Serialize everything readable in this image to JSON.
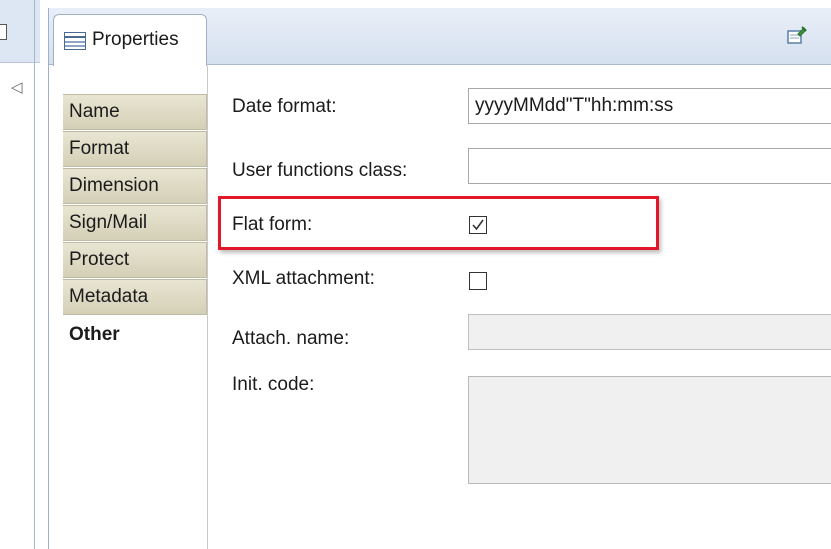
{
  "view": {
    "tab_title": "Properties",
    "tab_icon": "properties-table-icon",
    "toolbar_icon": "pin-editor-icon"
  },
  "tabs": [
    {
      "label": "Name",
      "active": false
    },
    {
      "label": "Format",
      "active": false
    },
    {
      "label": "Dimension",
      "active": false
    },
    {
      "label": "Sign/Mail",
      "active": false
    },
    {
      "label": "Protect",
      "active": false
    },
    {
      "label": "Metadata",
      "active": false
    },
    {
      "label": "Other",
      "active": true
    }
  ],
  "form": {
    "date_format_label": "Date format:",
    "date_format_value": "yyyyMMdd\"T\"hh:mm:ss",
    "user_functions_label": "User functions class:",
    "user_functions_value": "",
    "flat_form_label": "Flat form:",
    "flat_form_checked": true,
    "xml_attachment_label": "XML attachment:",
    "xml_attachment_checked": false,
    "attach_name_label": "Attach. name:",
    "attach_name_value": "",
    "init_code_label": "Init. code:",
    "init_code_value": ""
  },
  "colors": {
    "highlight": "#e2182a",
    "tab_bg": "#d4d0b7",
    "titlebar": "#d5e0ef"
  }
}
